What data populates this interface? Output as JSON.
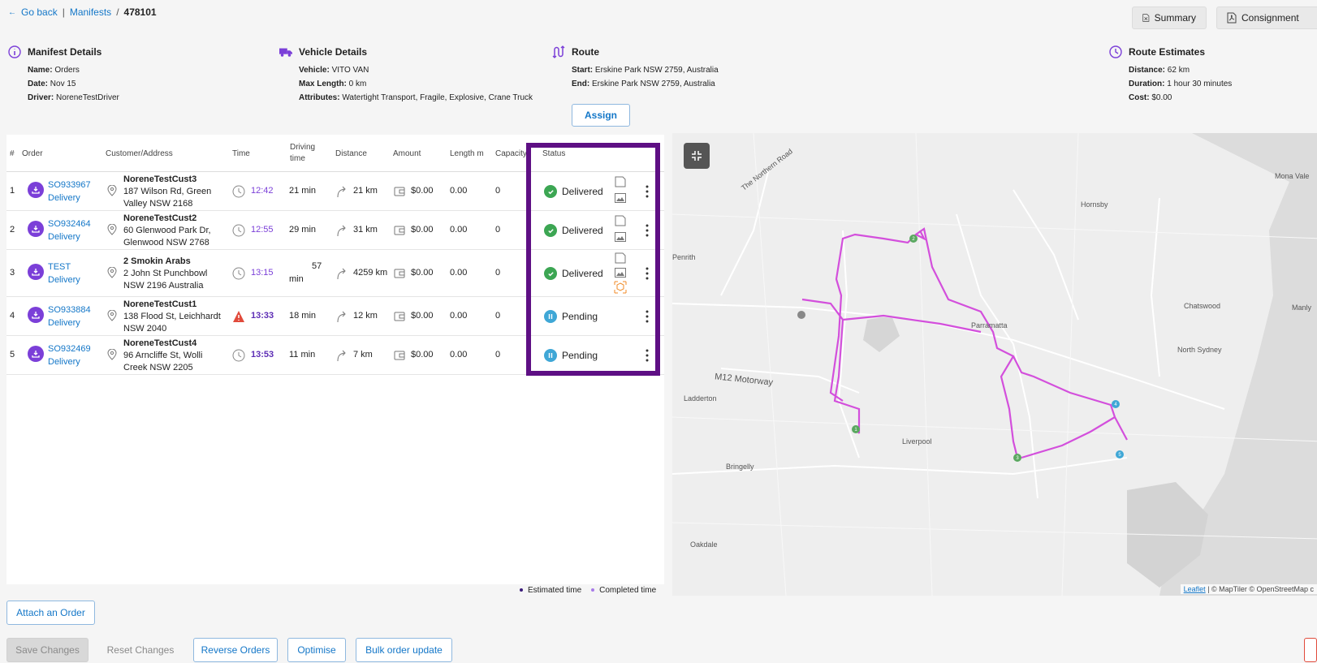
{
  "breadcrumb": {
    "back": "Go back",
    "sep": "|",
    "manifests": "Manifests",
    "slash": "/",
    "id": "478101"
  },
  "top_buttons": {
    "summary": "Summary",
    "consignment": "Consignment"
  },
  "manifest": {
    "title": "Manifest Details",
    "name_label": "Name:",
    "name": "Orders",
    "date_label": "Date:",
    "date": "Nov 15",
    "driver_label": "Driver:",
    "driver": "NoreneTestDriver"
  },
  "vehicle": {
    "title": "Vehicle Details",
    "vehicle_label": "Vehicle:",
    "vehicle": "VITO VAN",
    "maxlen_label": "Max Length:",
    "maxlen": "0 km",
    "attr_label": "Attributes:",
    "attr": "Watertight Transport, Fragile, Explosive, Crane Truck"
  },
  "route": {
    "title": "Route",
    "start_label": "Start:",
    "start": "Erskine Park NSW 2759, Australia",
    "end_label": "End:",
    "end": "Erskine Park NSW 2759, Australia",
    "assign": "Assign"
  },
  "estimates": {
    "title": "Route Estimates",
    "distance_label": "Distance:",
    "distance": "62 km",
    "duration_label": "Duration:",
    "duration": "1 hour 30 minutes",
    "cost_label": "Cost:",
    "cost": "$0.00"
  },
  "table": {
    "headers": {
      "num": "#",
      "order": "Order",
      "customer": "Customer/Address",
      "time": "Time",
      "driving_1": "Driving",
      "driving_2": "time",
      "distance": "Distance",
      "amount": "Amount",
      "length": "Length m",
      "capacity": "Capacity",
      "status": "Status"
    },
    "rows": [
      {
        "num": "1",
        "order": "SO933967",
        "type": "Delivery",
        "customer": "NoreneTestCust3",
        "addr1": "187 Wilson Rd, Green",
        "addr2": "Valley NSW 2168",
        "time": "12:42",
        "drive": "21 min",
        "distance": "21 km",
        "amount": "$0.00",
        "length": "0.00",
        "capacity": "0",
        "status": "Delivered"
      },
      {
        "num": "2",
        "order": "SO932464",
        "type": "Delivery",
        "customer": "NoreneTestCust2",
        "addr1": "60 Glenwood Park Dr,",
        "addr2": "Glenwood NSW 2768",
        "time": "12:55",
        "drive": "29 min",
        "distance": "31 km",
        "amount": "$0.00",
        "length": "0.00",
        "capacity": "0",
        "status": "Delivered"
      },
      {
        "num": "3",
        "order": "TEST",
        "type": "Delivery",
        "customer": "2 Smokin Arabs",
        "addr1": "2 John St Punchbowl",
        "addr2": "NSW 2196 Australia",
        "time": "13:15",
        "drive_1": "57",
        "drive_2": "min",
        "distance": "4259 km",
        "amount": "$0.00",
        "length": "0.00",
        "capacity": "0",
        "status": "Delivered"
      },
      {
        "num": "4",
        "order": "SO933884",
        "type": "Delivery",
        "customer": "NoreneTestCust1",
        "addr1": "138 Flood St, Leichhardt",
        "addr2": "NSW 2040",
        "time": "13:33",
        "drive": "18 min",
        "distance": "12 km",
        "amount": "$0.00",
        "length": "0.00",
        "capacity": "0",
        "status": "Pending"
      },
      {
        "num": "5",
        "order": "SO932469",
        "type": "Delivery",
        "customer": "NoreneTestCust4",
        "addr1": "96 Arncliffe St, Wolli",
        "addr2": "Creek NSW 2205",
        "time": "13:53",
        "drive": "11 min",
        "distance": "7 km",
        "amount": "$0.00",
        "length": "0.00",
        "capacity": "0",
        "status": "Pending"
      }
    ]
  },
  "legend": {
    "estimated": "Estimated time",
    "completed": "Completed time"
  },
  "map": {
    "attribution_leaflet": "Leaflet",
    "attribution_rest": "| © MapTiler © OpenStreetMap c",
    "labels": {
      "penrith": "Penrith",
      "parramatta": "Parramatta",
      "liverpool": "Liverpool",
      "hornsby": "Hornsby",
      "chatswood": "Chatswood",
      "north_sydney": "North Sydney",
      "manly": "Manly",
      "mona_vale": "Mona Vale",
      "m12": "M12 Motorway",
      "northern_road": "The Northern Road",
      "ladderton": "Ladderton",
      "oakdale": "Oakdale",
      "bringelly": "Bringelly"
    }
  },
  "actions": {
    "attach": "Attach an Order",
    "save": "Save Changes",
    "reset": "Reset Changes",
    "reverse": "Reverse Orders",
    "optimise": "Optimise",
    "bulk": "Bulk order update"
  },
  "colors": {
    "accent": "#1477c8",
    "purple": "#7b3fd8",
    "delivered": "#3ca653",
    "pending": "#3fa7d6",
    "highlight": "#5e0f84",
    "route": "#d34fdc"
  }
}
